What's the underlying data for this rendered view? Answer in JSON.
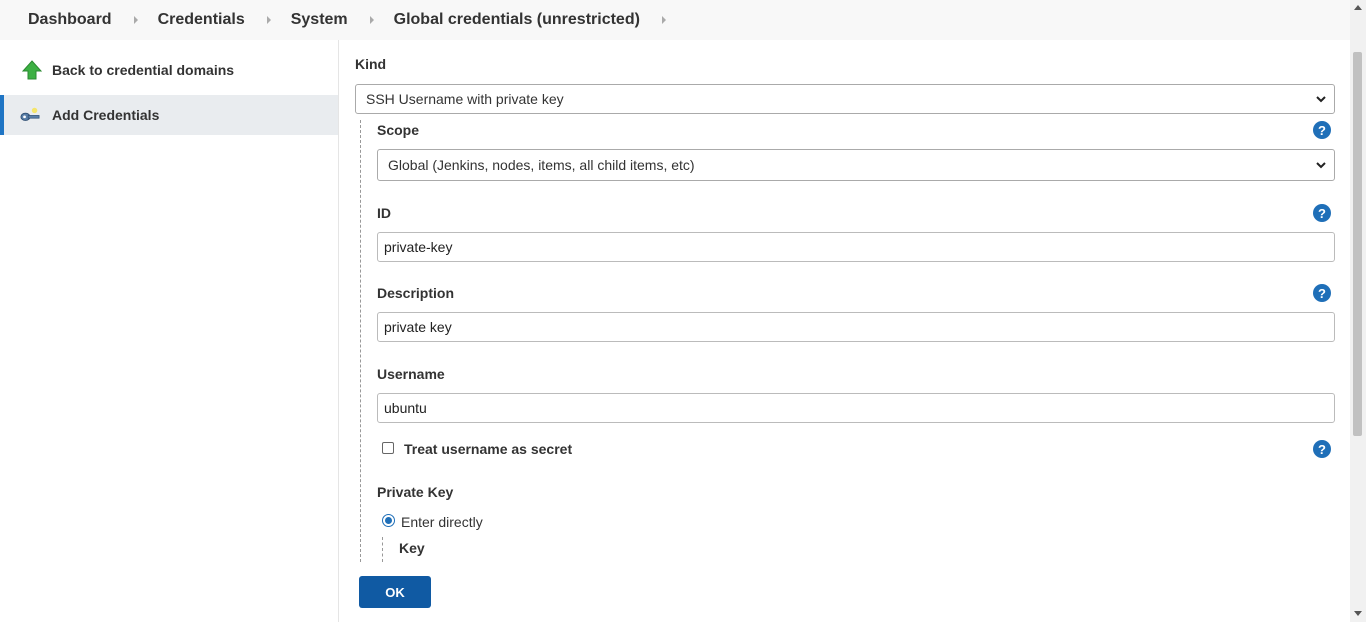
{
  "breadcrumb": {
    "items": [
      "Dashboard",
      "Credentials",
      "System",
      "Global credentials (unrestricted)"
    ]
  },
  "sidebar": {
    "back_label": "Back to credential domains",
    "add_label": "Add Credentials"
  },
  "form": {
    "kind_label": "Kind",
    "kind_value": "SSH Username with private key",
    "scope_label": "Scope",
    "scope_value": "Global (Jenkins, nodes, items, all child items, etc)",
    "id_label": "ID",
    "id_value": "private-key",
    "description_label": "Description",
    "description_value": "private key",
    "username_label": "Username",
    "username_value": "ubuntu",
    "treat_secret_label": "Treat username as secret",
    "treat_secret_checked": false,
    "private_key_label": "Private Key",
    "enter_directly_label": "Enter directly",
    "key_label": "Key",
    "help_glyph": "?",
    "ok_label": "OK"
  },
  "colors": {
    "accent": "#1f75c4",
    "button": "#105aa3",
    "help": "#1f6fb8"
  }
}
